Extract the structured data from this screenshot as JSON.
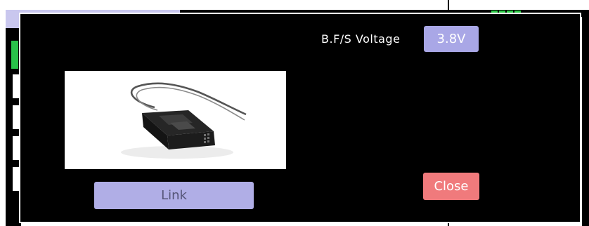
{
  "dialog": {
    "voltage_label": "B.F/S Voltage",
    "voltage_value": "3.8V",
    "link_label": "Link",
    "close_label": "Close"
  },
  "colors": {
    "dialog_background": "#000000",
    "value_box": "#a9a7e6",
    "link_button": "#b0aee6",
    "close_button": "#f07a7c",
    "battery_indicator": "#2dcc47"
  },
  "icons": {
    "product_image": "receiver-module-image"
  }
}
